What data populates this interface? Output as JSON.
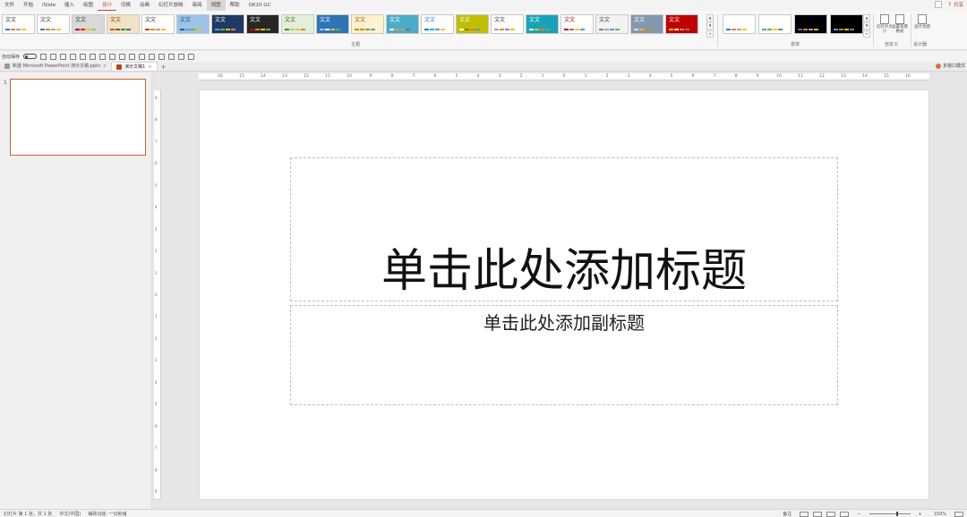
{
  "menu": {
    "items": [
      "文件",
      "开始",
      "iSlide",
      "插入",
      "绘图",
      "设计",
      "切换",
      "动画",
      "幻灯片放映",
      "审阅",
      "视图",
      "帮助",
      "OK10 GC"
    ],
    "active_index": 5,
    "highlight_index": 10,
    "share_label": "共享"
  },
  "ribbon": {
    "themes": [
      {
        "label": "文文",
        "bg": "#ffffff",
        "fg": "#333333",
        "dots": [
          "#4472c4",
          "#ed7d31",
          "#a5a5a5",
          "#ffc000"
        ]
      },
      {
        "label": "文文",
        "bg": "#ffffff",
        "fg": "#333333",
        "dots": [
          "#4472c4",
          "#ed7d31",
          "#a5a5a5",
          "#ffc000"
        ]
      },
      {
        "label": "文文",
        "bg": "#d9d9d9",
        "fg": "#333333",
        "dots": [
          "#c00000",
          "#ff0000",
          "#ffc000",
          "#92d050"
        ]
      },
      {
        "label": "文文",
        "bg": "#f2e3c6",
        "fg": "#7f3f00",
        "dots": [
          "#c55a11",
          "#7f6000",
          "#548235",
          "#2e75b6"
        ]
      },
      {
        "label": "文文",
        "bg": "#ffffff",
        "fg": "#333333",
        "dots": [
          "#c43e1c",
          "#ed7d31",
          "#a5a5a5",
          "#ffc000"
        ]
      },
      {
        "label": "文文",
        "bg": "#9dc3e6",
        "fg": "#1f4e79",
        "dots": [
          "#2f5597",
          "#5b9bd5",
          "#70ad47",
          "#ffc000"
        ]
      },
      {
        "label": "文文",
        "bg": "#1f3864",
        "fg": "#ffffff",
        "dots": [
          "#5b9bd5",
          "#70ad47",
          "#ffc000",
          "#ed7d31"
        ]
      },
      {
        "label": "文文",
        "bg": "#262626",
        "fg": "#ffffff",
        "dots": [
          "#c00000",
          "#ed7d31",
          "#ffc000",
          "#70ad47"
        ]
      },
      {
        "label": "文文",
        "bg": "#e2efda",
        "fg": "#375623",
        "dots": [
          "#548235",
          "#a9d18e",
          "#ffc000",
          "#ed7d31"
        ]
      },
      {
        "label": "文文",
        "bg": "#2e75b6",
        "fg": "#ffffff",
        "dots": [
          "#9dc3e6",
          "#ffffff",
          "#ffc000",
          "#70ad47"
        ]
      },
      {
        "label": "文文",
        "bg": "#fff2cc",
        "fg": "#7f6000",
        "dots": [
          "#bf9000",
          "#ed7d31",
          "#70ad47",
          "#5b9bd5"
        ]
      },
      {
        "label": "文文",
        "bg": "#4bacc6",
        "fg": "#ffffff",
        "dots": [
          "#ffffff",
          "#f79646",
          "#9bbb59",
          "#8064a2"
        ]
      },
      {
        "label": "文文",
        "bg": "#ffffff",
        "fg": "#2e75b6",
        "dots": [
          "#2e75b6",
          "#00b0f0",
          "#5b9bd5",
          "#ffc000"
        ]
      },
      {
        "label": "文文",
        "bg": "#bfbf00",
        "fg": "#ffffff",
        "dots": [
          "#ffffff",
          "#7f7f00",
          "#ed7d31",
          "#5b9bd5"
        ]
      },
      {
        "label": "文文",
        "bg": "#ffffff",
        "fg": "#333333",
        "dots": [
          "#a5a5a5",
          "#ed7d31",
          "#5b9bd5",
          "#ffc000"
        ]
      },
      {
        "label": "文文",
        "bg": "#17a2b8",
        "fg": "#ffffff",
        "dots": [
          "#ffffff",
          "#ffc000",
          "#ed7d31",
          "#70ad47"
        ]
      },
      {
        "label": "文文",
        "bg": "#ffffff",
        "fg": "#c00000",
        "dots": [
          "#c00000",
          "#7f7f7f",
          "#ffc000",
          "#5b9bd5"
        ]
      },
      {
        "label": "文文",
        "bg": "#f2f2f2",
        "fg": "#404040",
        "dots": [
          "#7f7f7f",
          "#a5a5a5",
          "#5b9bd5",
          "#70ad47"
        ]
      },
      {
        "label": "文文",
        "bg": "#8497b0",
        "fg": "#ffffff",
        "dots": [
          "#d6dce4",
          "#ffc000",
          "#ed7d31",
          "#70ad47"
        ]
      },
      {
        "label": "文文",
        "bg": "#c00000",
        "fg": "#ffffff",
        "dots": [
          "#ffc000",
          "#ffffff",
          "#ed7d31",
          "#7f7f7f"
        ]
      }
    ],
    "variants": [
      {
        "bg": "#ffffff",
        "dots": [
          "#4472c4",
          "#ed7d31",
          "#a5a5a5",
          "#ffc000"
        ]
      },
      {
        "bg": "#ffffff",
        "dots": [
          "#5b9bd5",
          "#70ad47",
          "#ffc000",
          "#7f7f7f"
        ]
      },
      {
        "bg": "#000000",
        "dots": [
          "#4472c4",
          "#ed7d31",
          "#a5a5a5",
          "#ffc000"
        ]
      },
      {
        "bg": "#000000",
        "dots": [
          "#5b9bd5",
          "#70ad47",
          "#ffc000",
          "#7f7f7f"
        ]
      }
    ],
    "group_themes": "主题",
    "group_variants": "变体",
    "group_custom": "自定义",
    "group_designer": "设计器",
    "btn_slide_size": "幻灯片大小",
    "btn_format_bg": "设置背景格式",
    "btn_design_ideas": "设计灵感"
  },
  "qat": {
    "autosave_label": "自动保存"
  },
  "doctabs": [
    {
      "label": "新建 Microsoft PowerPoint 演示文稿.pptx",
      "active": false
    },
    {
      "label": "演示文稿1",
      "active": true
    }
  ],
  "multiwindow_label": "多窗口模式",
  "thumbnails": {
    "slide_number": "1"
  },
  "ruler": {
    "h_labels": [
      "16",
      "15",
      "14",
      "13",
      "12",
      "11",
      "10",
      "9",
      "8",
      "7",
      "6",
      "5",
      "4",
      "3",
      "2",
      "1",
      "0",
      "1",
      "2",
      "3",
      "4",
      "5",
      "6",
      "7",
      "8",
      "9",
      "10",
      "11",
      "12",
      "13",
      "14",
      "15",
      "16"
    ],
    "v_labels": [
      "9",
      "8",
      "7",
      "6",
      "5",
      "4",
      "3",
      "2",
      "1",
      "0",
      "1",
      "2",
      "3",
      "4",
      "5",
      "6",
      "7",
      "8",
      "9"
    ]
  },
  "slide": {
    "title_placeholder": "单击此处添加标题",
    "subtitle_placeholder": "单击此处添加副标题"
  },
  "status": {
    "slide_info": "幻灯片 第 1 张，共 1 张",
    "language": "中文(中国)",
    "accessibility": "辅助功能: 一切就绪",
    "notes": "备注",
    "zoom": "150%"
  }
}
